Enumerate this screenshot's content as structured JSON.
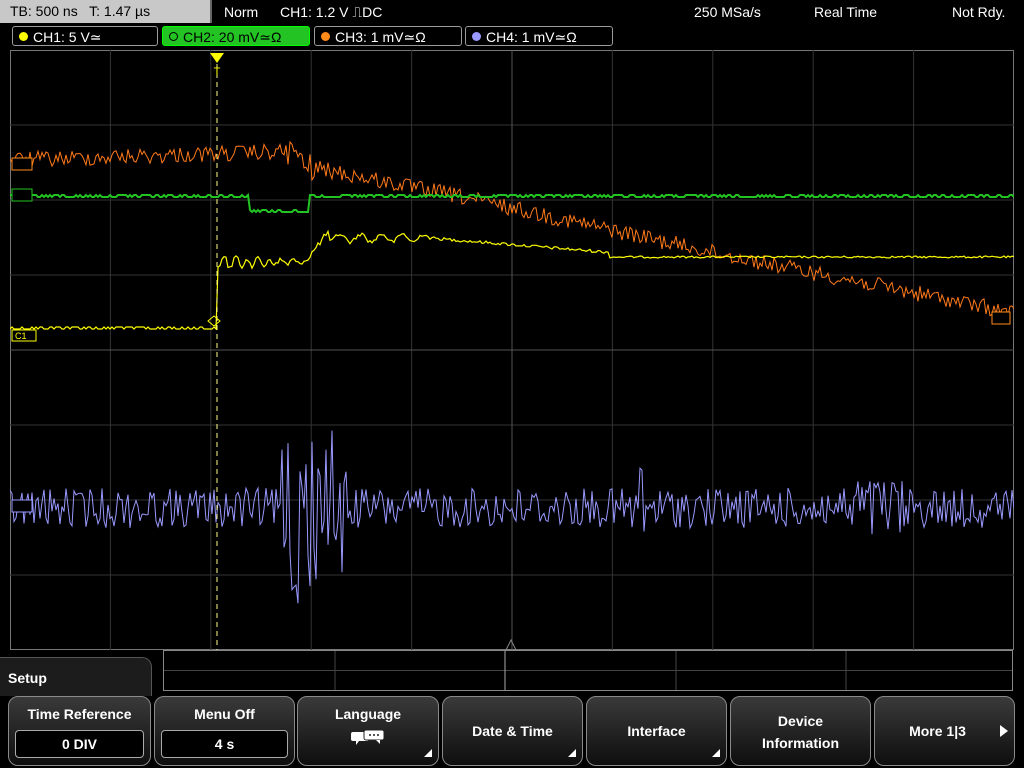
{
  "status": {
    "timebase": "TB: 500 ns",
    "trigger_time": "T: 1.47 µs",
    "trigger_mode": "Norm",
    "trigger_source": "CH1: 1.2 V ⎍DC",
    "sample_rate": "250 MSa/s",
    "acq_mode": "Real Time",
    "state": "Not Rdy."
  },
  "channels": [
    {
      "label": "CH1: 5 V≃",
      "color": "#ffff00",
      "active": false
    },
    {
      "label": "CH2: 20 mV≃Ω",
      "color": "#22c322",
      "active": true
    },
    {
      "label": "CH3: 1 mV≃Ω",
      "color": "#ff8c1a",
      "active": false
    },
    {
      "label": "CH4: 1 mV≃Ω",
      "color": "#9999ff",
      "active": false
    }
  ],
  "markers": {
    "c1_left": "C1",
    "trigger_marker": "T"
  },
  "menu": {
    "title": "Setup",
    "softkeys": [
      {
        "label": "Time Reference",
        "value": "0 DIV"
      },
      {
        "label": "Menu Off",
        "value": "4 s"
      },
      {
        "label": "Language",
        "icon": "speech-bubbles-icon"
      },
      {
        "label": "Date & Time"
      },
      {
        "label": "Interface"
      },
      {
        "label": "Device",
        "label2": "Information"
      },
      {
        "label": "More 1|3"
      }
    ]
  }
}
